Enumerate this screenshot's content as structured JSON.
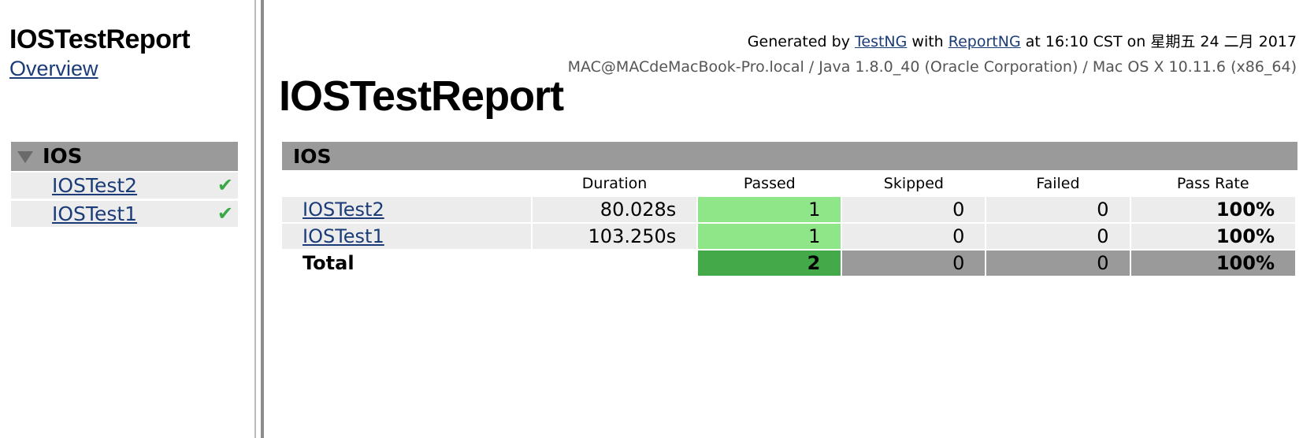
{
  "nav": {
    "title": "IOSTestReport",
    "overview_link": "Overview",
    "suite": {
      "name": "IOS",
      "tests": [
        {
          "name": "IOSTest2",
          "status_mark": "✔"
        },
        {
          "name": "IOSTest1",
          "status_mark": "✔"
        }
      ]
    }
  },
  "header": {
    "generated_prefix": "Generated by",
    "testng_link": "TestNG",
    "with_text": "with",
    "reportng_link": "ReportNG",
    "generated_suffix": "at 16:10 CST on 星期五 24 二月 2017",
    "system_info": "MAC@MACdeMacBook-Pro.local / Java 1.8.0_40 (Oracle Corporation) / Mac OS X 10.11.6 (x86_64)"
  },
  "main": {
    "title": "IOSTestReport",
    "suite_name": "IOS",
    "columns": [
      "",
      "Duration",
      "Passed",
      "Skipped",
      "Failed",
      "Pass Rate"
    ],
    "rows": [
      {
        "name": "IOSTest2",
        "duration": "80.028s",
        "passed": "1",
        "skipped": "0",
        "failed": "0",
        "pass_rate": "100%"
      },
      {
        "name": "IOSTest1",
        "duration": "103.250s",
        "passed": "1",
        "skipped": "0",
        "failed": "0",
        "pass_rate": "100%"
      }
    ],
    "total": {
      "label": "Total",
      "passed": "2",
      "skipped": "0",
      "failed": "0",
      "pass_rate": "100%"
    }
  },
  "colors": {
    "link": "#1b3c78",
    "suite_bar": "#9a9a9a",
    "row_bg": "#ececec",
    "pass_light": "#8ee688",
    "pass_dark": "#44a949",
    "check": "#39a845"
  },
  "icons": {
    "suite_toggle": "triangle-down-icon",
    "test_status": "checkmark-icon"
  }
}
